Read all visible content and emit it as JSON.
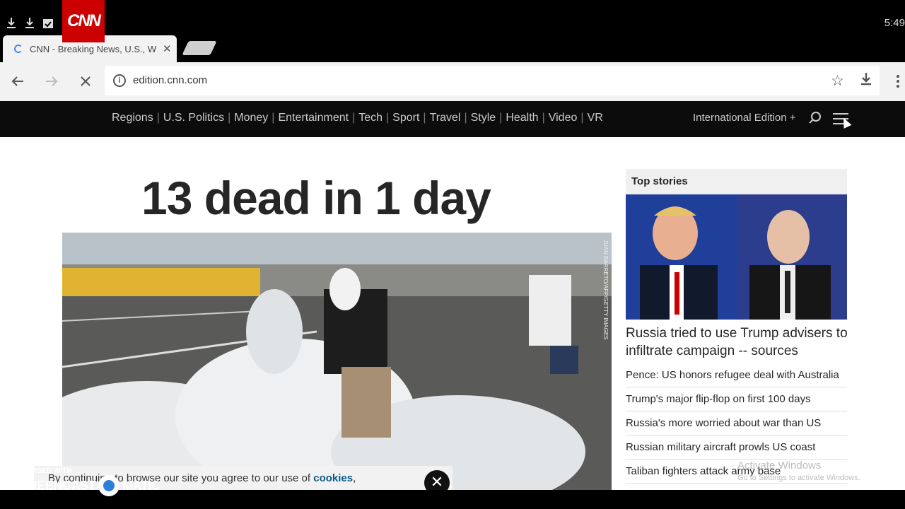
{
  "status_bar": {
    "clock": "5:49"
  },
  "tab": {
    "title": "CNN - Breaking News, U.S., W"
  },
  "omnibox": {
    "url": "edition.cnn.com"
  },
  "nav": {
    "logo": "CNN",
    "items": [
      "Regions",
      "U.S. Politics",
      "Money",
      "Entertainment",
      "Tech",
      "Sport",
      "Travel",
      "Style",
      "Health",
      "Video",
      "VR"
    ],
    "edition": "International Edition +"
  },
  "main": {
    "headline": "13 dead in 1 day",
    "photo_credit": "JUAN BARRETO/AFP/GETTY IMAGES"
  },
  "cookie_banner": {
    "text_before": "By continuing to browse our site you agree to our use of ",
    "link": "cookies",
    "text_after": ","
  },
  "top_stories": {
    "label": "Top stories",
    "main_story": "Russia tried to use Trump advisers to infiltrate campaign -- sources",
    "stories": [
      "Pence: US honors refugee deal with Australia",
      "Trump's major flip-flop on first 100 days",
      "Russia's more worried about war than US",
      "Russian military aircraft prowls US coast",
      "Taliban fighters attack army base"
    ]
  },
  "watermark": {
    "line1": "Activate Windows",
    "line2": "Go to Settings to activate Windows."
  },
  "recorder": {
    "line1": "RECORDED WITH",
    "line2a": "SCREENCAST",
    "line2b": "MATIC"
  }
}
